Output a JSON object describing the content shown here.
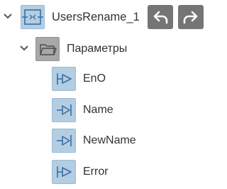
{
  "tree": {
    "root": {
      "label": "UsersRename_1",
      "icon": "function-block-icon",
      "expanded": true
    },
    "folder": {
      "label": "Параметры",
      "icon": "folder-icon",
      "expanded": true
    },
    "params": [
      {
        "label": "EnO",
        "icon": "output-param-icon"
      },
      {
        "label": "Name",
        "icon": "input-param-icon"
      },
      {
        "label": "NewName",
        "icon": "input-param-icon"
      },
      {
        "label": "Error",
        "icon": "output-param-icon"
      }
    ]
  },
  "toolbar": {
    "undo_icon": "undo-icon",
    "redo_icon": "redo-icon"
  },
  "colors": {
    "icon_blue": "#b3cde3",
    "folder_gray": "#a8a8a8",
    "button_gray": "#757575",
    "text": "#333333"
  }
}
